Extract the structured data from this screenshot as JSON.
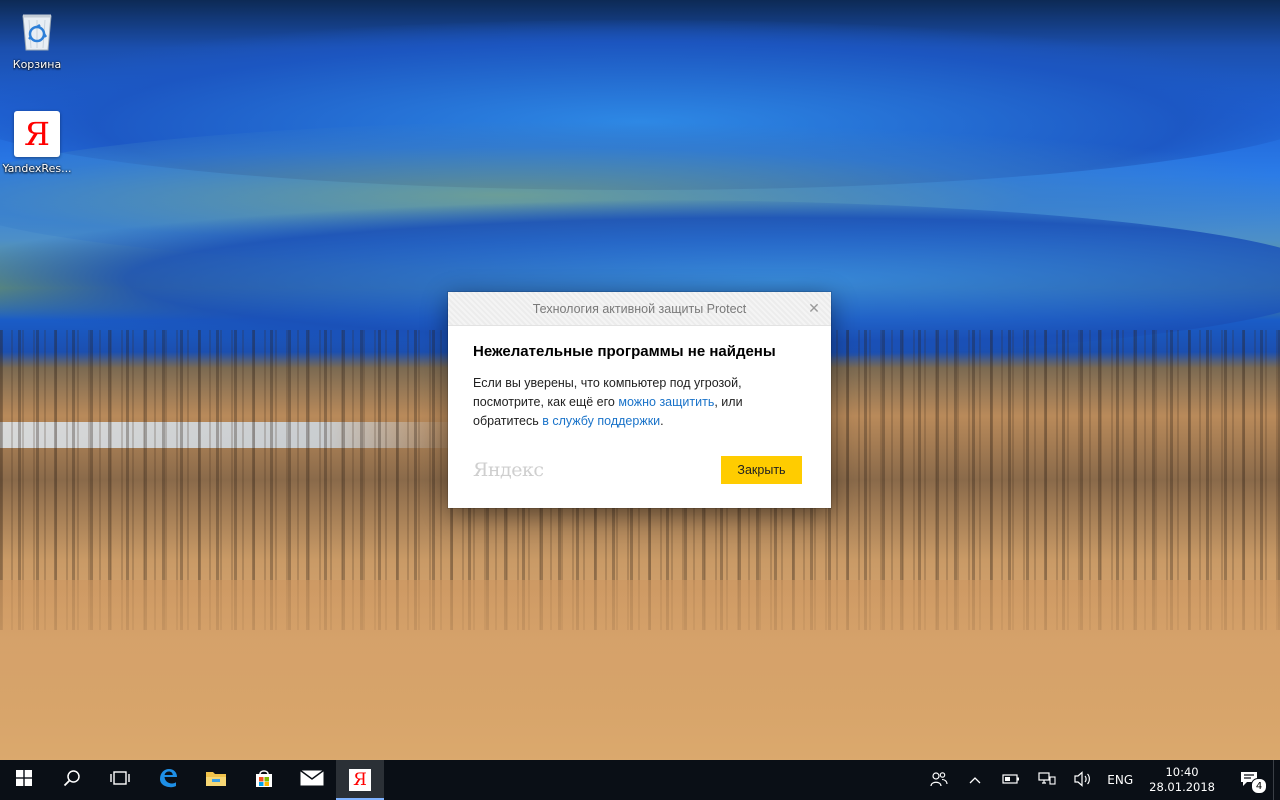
{
  "desktop": {
    "icons": [
      {
        "label": "Корзина",
        "icon": "recycle-bin-icon"
      },
      {
        "label": "YandexRes...",
        "icon": "yandex-icon",
        "glyph": "Я"
      }
    ]
  },
  "dialog": {
    "title": "Технология активной защиты Protect",
    "close_glyph": "✕",
    "heading": "Нежелательные программы не найдены",
    "text_part1": "Если вы уверены, что компьютер под угрозой, посмотрите, как ещё его ",
    "link1": "можно защитить",
    "text_part2": ", или обратитесь ",
    "link2": "в службу поддержки",
    "text_part3": ".",
    "brand": "Яндекс",
    "button_label": "Закрыть",
    "accent_color": "#ffcc00",
    "link_color": "#1a73c9"
  },
  "taskbar": {
    "pinned": [
      {
        "name": "start",
        "icon": "windows-logo-icon"
      },
      {
        "name": "search",
        "icon": "search-icon"
      },
      {
        "name": "task-view",
        "icon": "task-view-icon"
      },
      {
        "name": "edge",
        "icon": "edge-icon"
      },
      {
        "name": "file-explorer",
        "icon": "folder-icon"
      },
      {
        "name": "store",
        "icon": "store-icon"
      },
      {
        "name": "mail",
        "icon": "mail-icon"
      },
      {
        "name": "yandex",
        "icon": "yandex-icon",
        "glyph": "Я"
      }
    ],
    "tray": {
      "language": "ENG",
      "time": "10:40",
      "date": "28.01.2018",
      "notifications": "4"
    }
  }
}
